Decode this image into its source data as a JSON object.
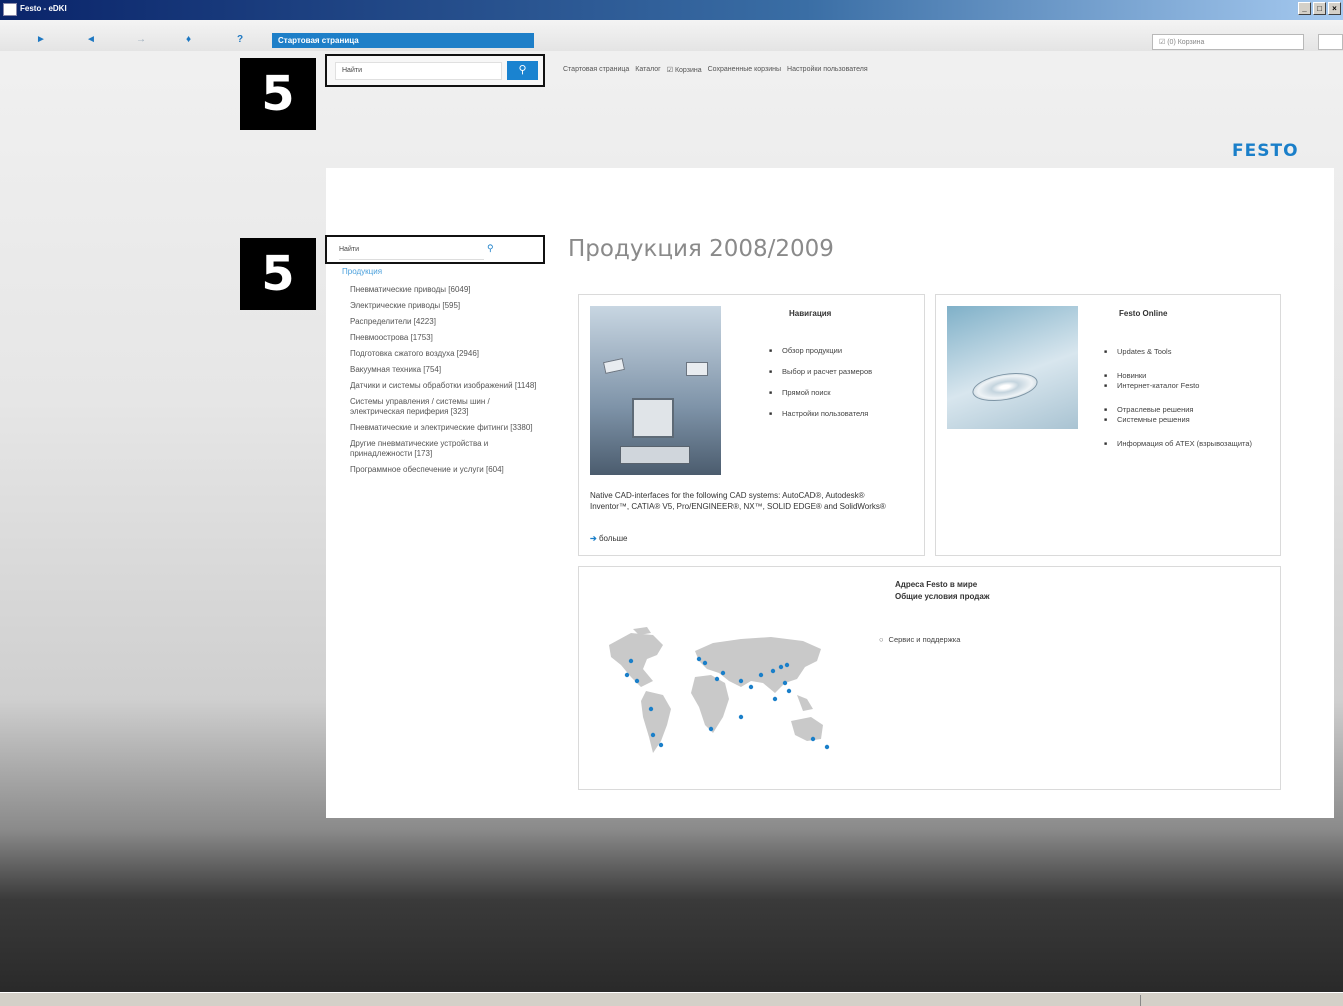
{
  "window": {
    "title": "Festo - eDKI"
  },
  "toolbar": {
    "nav": [
      "►",
      "◄",
      "→",
      "♦",
      "?"
    ],
    "address": "Стартовая страница",
    "cart_box": "☑ (0) Корзина"
  },
  "top_search": {
    "placeholder": "Найти",
    "button_icon": "search-icon"
  },
  "topnav": [
    "Стартовая страница",
    "Каталог",
    "☑ Корзина",
    "Сохраненные корзины",
    "Настройки пользователя"
  ],
  "markers": [
    "5",
    "5"
  ],
  "brand": "FESTO",
  "sidebar": {
    "search_placeholder": "Найти",
    "products_link": "Продукция",
    "categories": [
      "Пневматические приводы [6049]",
      "Электрические приводы [595]",
      "Распределители [4223]",
      "Пневмоострова [1753]",
      "Подготовка сжатого воздуха [2946]",
      "Вакуумная техника [754]",
      "Датчики и системы обработки изображений [1148]",
      "Системы управления / системы шин / электрическая периферия [323]",
      "Пневматические и электрические фитинги [3380]",
      "Другие пневматические устройства и принадлежности [173]",
      "Программное обеспечение и услуги [604]"
    ]
  },
  "main": {
    "heading": "Продукция 2008/2009",
    "navigation": {
      "title": "Навигация",
      "items": [
        "Обзор продукции",
        "Выбор и расчет размеров",
        "Прямой поиск",
        "Настройки пользователя"
      ],
      "cad_text": "Native CAD-interfaces for the following CAD systems: AutoCAD®, Autodesk® Inventor™, CATIA® V5, Pro/ENGINEER®, NX™, SOLID EDGE® and SolidWorks®",
      "more": "больше"
    },
    "online": {
      "title": "Festo Online",
      "items": [
        "Updates & Tools",
        "Новинки",
        "Интернет-каталог Festo",
        "Отраслевые решения",
        "Системные решения",
        "Информация об ATEX (взрывозащита)"
      ]
    },
    "world": {
      "line1": "Адреса Festo в мире",
      "line2": "Общие условия продаж",
      "service": "Сервис и поддержка"
    }
  }
}
